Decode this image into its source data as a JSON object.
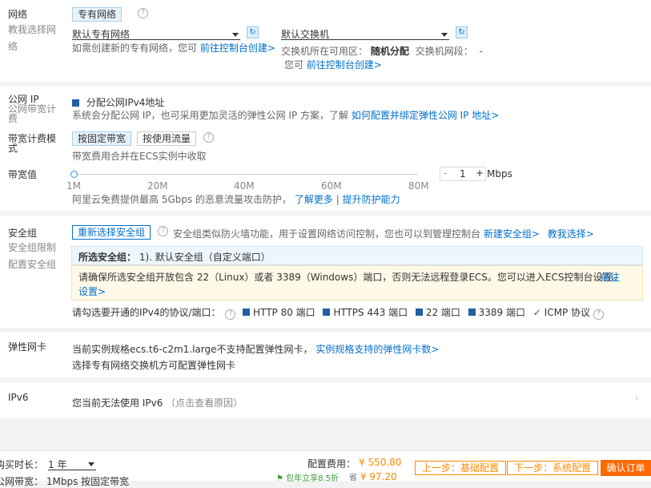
{
  "network": {
    "label": "网络",
    "sublabel_1": "教我选择网",
    "sublabel_2": "络",
    "type_tab": "专有网络",
    "vpc_select": "默认专有网络",
    "vswitch_select": "默认交换机",
    "hint_prefix": "如需创建新的专有网络，您可",
    "hint_link": "前往控制台创建>",
    "zone_prefix": "交换机所在可用区：",
    "zone_value": "随机分配",
    "segment_label": "交换机网段：",
    "segment_value": "-",
    "vswitch_hint_prefix": "您可",
    "vswitch_hint_link": "前往控制台创建>"
  },
  "public_ip": {
    "label": "公网 IP",
    "sublabel_1": "公网带宽计",
    "sublabel_2": "费",
    "checkbox_label": "分配公网IPv4地址",
    "desc": "系统会分配公网 IP，也可采用更加灵活的弹性公网 IP 方案，了解",
    "desc_link": "如何配置并绑定弹性公网 IP 地址>"
  },
  "billing": {
    "label_1": "带宽计费模",
    "label_2": "式",
    "option_fixed": "按固定带宽",
    "option_traffic": "按使用流量",
    "desc": "带宽费用合并在ECS实例中收取"
  },
  "bandwidth": {
    "label": "带宽值",
    "ticks": [
      "1M",
      "20M",
      "40M",
      "60M",
      "80M"
    ],
    "value": "1",
    "unit": "Mbps",
    "minus": "-",
    "plus": "+",
    "note": "阿里云免费提供最高 5Gbps 的恶意流量攻击防护，",
    "link_more": "了解更多",
    "separator": "|",
    "link_protect": "提升防护能力"
  },
  "security_group": {
    "label": "安全组",
    "sublabel_1": "安全组限制",
    "sublabel_2": "配置安全组",
    "reselect_button": "重新选择安全组",
    "desc": "安全组类似防火墙功能，用于设置网络访问控制，您也可以到管理控制台",
    "link_new": "新建安全组>",
    "link_teach": "教我选择>",
    "selected_label": "所选安全组：",
    "selected_value": "1). 默认安全组（自定义端口）",
    "warning": "请确保所选安全组开放包含 22（Linux）或者 3389（Windows）端口，否则无法远程登录ECS。您可以进入ECS控制台设置。",
    "warning_link_1": "前往",
    "warning_link_2": "设置>",
    "ports_label": "请勾选要开通的IPv4的协议/端口：",
    "ports": [
      "HTTP 80 端口",
      "HTTPS 443 端口",
      "22 端口",
      "3389 端口"
    ],
    "icmp": "ICMP 协议"
  },
  "eni": {
    "label": "弹性网卡",
    "desc_prefix": "当前实例规格ecs.t6-c2m1.large不支持配置弹性网卡，",
    "desc_link": "实例规格支持的弹性网卡数>",
    "desc_2": "选择专有网络交换机方可配置弹性网卡"
  },
  "ipv6": {
    "label": "IPv6",
    "desc": "您当前无法使用 IPv6",
    "desc_hint": "（点击查看原因）",
    "chevron": "›"
  },
  "footer": {
    "duration_label": "购买时长：",
    "duration_value": "1 年",
    "bandwidth_label": "公网带宽：",
    "bandwidth_value": "1Mbps 按固定带宽",
    "config_fee_label": "配置费用：",
    "config_fee_value": "¥ 550.80",
    "discount_label": "包年立享8.5折",
    "discount_value": "¥ 97.20",
    "prev_button": "上一步：基础配置",
    "next_button": "下一步：系统配置",
    "confirm_button": "确认订单"
  },
  "colors": {
    "link": "#0070cc",
    "accent": "#ff8a00",
    "checkbox": "#1f5fa3"
  }
}
